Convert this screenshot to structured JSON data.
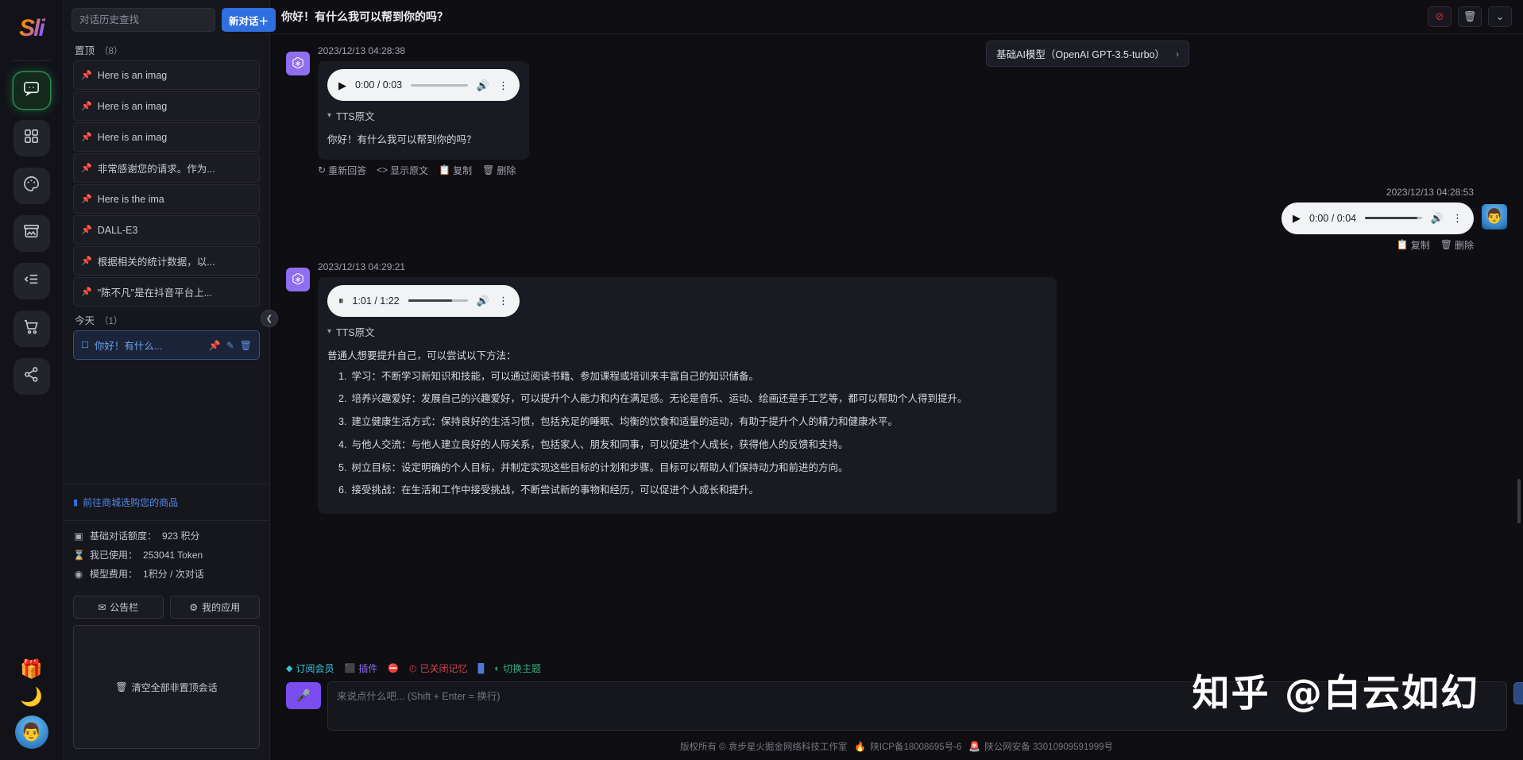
{
  "rail": {
    "logo_text": "Sli",
    "items": [
      {
        "name": "chat",
        "icon": "chat-bubble-icon",
        "active": true
      },
      {
        "name": "apps",
        "icon": "grid-apps-icon",
        "active": false
      },
      {
        "name": "draw",
        "icon": "palette-icon",
        "active": false
      },
      {
        "name": "gallery",
        "icon": "image-archive-icon",
        "active": false
      },
      {
        "name": "list",
        "icon": "list-indent-icon",
        "active": false
      },
      {
        "name": "shop",
        "icon": "shopping-cart-icon",
        "active": false
      },
      {
        "name": "share",
        "icon": "share-nodes-icon",
        "active": false
      }
    ],
    "gift_emoji": "🎁",
    "moon_emoji": "🌙",
    "avatar_emoji": "👨"
  },
  "sidebar": {
    "search_placeholder": "对话历史查找",
    "new_chat_label": "新对话＋",
    "pinned_label": "置顶",
    "pinned_count": "（8）",
    "today_label": "今天",
    "today_count": "（1）",
    "pinned": [
      {
        "title": "Here is an imag"
      },
      {
        "title": "Here is an imag"
      },
      {
        "title": "Here is an imag"
      },
      {
        "title": "非常感谢您的请求。作为..."
      },
      {
        "title": "Here is the ima"
      },
      {
        "title": "DALL-E3"
      },
      {
        "title": "根据相关的统计数据，以..."
      },
      {
        "title": "\"陈不凡\"是在抖音平台上..."
      }
    ],
    "today": [
      {
        "title": "你好！有什么..."
      }
    ],
    "shop_link": "前往商城选购您的商品",
    "stats": [
      {
        "icon": "credit-icon",
        "label": "基础对话额度：",
        "value": "923 积分"
      },
      {
        "icon": "hourglass-icon",
        "label": "我已使用：",
        "value": "253041 Token"
      },
      {
        "icon": "coin-icon",
        "label": "模型费用：",
        "value": "1积分 / 次对话"
      }
    ],
    "announce_btn": "公告栏",
    "myapps_btn": "我的应用",
    "clear_btn": "清空全部非置顶会话"
  },
  "header": {
    "title": "你好！有什么我可以帮到你的吗？",
    "actions": [
      {
        "name": "headset-mute-icon",
        "glyph": "⊘"
      },
      {
        "name": "trash-icon",
        "glyph": "🗑"
      },
      {
        "name": "chevron-down-icon",
        "glyph": "⌄"
      }
    ]
  },
  "model_pill": {
    "label": "基础AI模型（OpenAI GPT-3.5-turbo）",
    "chevron": "›"
  },
  "messages": [
    {
      "role": "assistant",
      "timestamp": "2023/12/13 04:28:38",
      "audio": {
        "current": "0:00",
        "total": "0:03",
        "progress_pct": 0,
        "state": "paused",
        "play_glyph": "▶"
      },
      "tts_label": "TTS原文",
      "tts_text": "你好！有什么我可以帮到你的吗？",
      "actions": [
        "重新回答",
        "显示原文",
        "复制",
        "删除"
      ]
    },
    {
      "role": "user",
      "timestamp": "2023/12/13 04:28:53",
      "audio": {
        "current": "0:00",
        "total": "0:04",
        "progress_pct": 92,
        "state": "paused",
        "play_glyph": "▶"
      },
      "actions": [
        "复制",
        "删除"
      ]
    },
    {
      "role": "assistant",
      "timestamp": "2023/12/13 04:29:21",
      "audio": {
        "current": "1:01",
        "total": "1:22",
        "progress_pct": 74,
        "state": "playing",
        "play_glyph": "⏸"
      },
      "tts_label": "TTS原文",
      "intro": "普通人想要提升自己，可以尝试以下方法：",
      "list": [
        {
          "num": "1.",
          "text": "学习：不断学习新知识和技能，可以通过阅读书籍、参加课程或培训来丰富自己的知识储备。"
        },
        {
          "num": "2.",
          "text": "培养兴趣爱好：发展自己的兴趣爱好，可以提升个人能力和内在满足感。无论是音乐、运动、绘画还是手工艺等，都可以帮助个人得到提升。"
        },
        {
          "num": "3.",
          "text": "建立健康生活方式：保持良好的生活习惯，包括充足的睡眠、均衡的饮食和适量的运动，有助于提升个人的精力和健康水平。"
        },
        {
          "num": "4.",
          "text": "与他人交流：与他人建立良好的人际关系，包括家人、朋友和同事，可以促进个人成长，获得他人的反馈和支持。"
        },
        {
          "num": "5.",
          "text": "树立目标：设定明确的个人目标，并制定实现这些目标的计划和步骤。目标可以帮助人们保持动力和前进的方向。"
        },
        {
          "num": "6.",
          "text": "接受挑战：在生活和工作中接受挑战，不断尝试新的事物和经历，可以促进个人成长和提升。"
        }
      ]
    }
  ],
  "quick_bar": [
    {
      "name": "subscribe",
      "icon": "gem-icon",
      "glyph": "◆",
      "label": "订阅会员"
    },
    {
      "name": "plugin",
      "icon": "plugin-icon",
      "glyph": "⬛",
      "label": "插件"
    },
    {
      "name": "stop",
      "icon": "stop-circle-icon",
      "glyph": "⛔",
      "label": ""
    },
    {
      "name": "memory",
      "icon": "clock-off-icon",
      "glyph": "◴",
      "label": "已关闭记忆"
    },
    {
      "name": "stats",
      "icon": "bar-chart-icon",
      "glyph": "█",
      "label": ""
    },
    {
      "name": "theme",
      "icon": "toggle-icon",
      "glyph": "◐",
      "label": "切换主题"
    }
  ],
  "composer": {
    "mic_icon": "microphone-icon",
    "placeholder": "来说点什么吧... (Shift + Enter = 换行)",
    "value": "",
    "send_icon": "send-arrow-icon"
  },
  "watermark": "知乎 @白云如幻",
  "footer": {
    "copyright": "版权所有 © 袁步星火掘金网络科技工作室",
    "icp": "陕ICP备18008695号-6",
    "police": "陕公网安备 33010909591999号"
  }
}
